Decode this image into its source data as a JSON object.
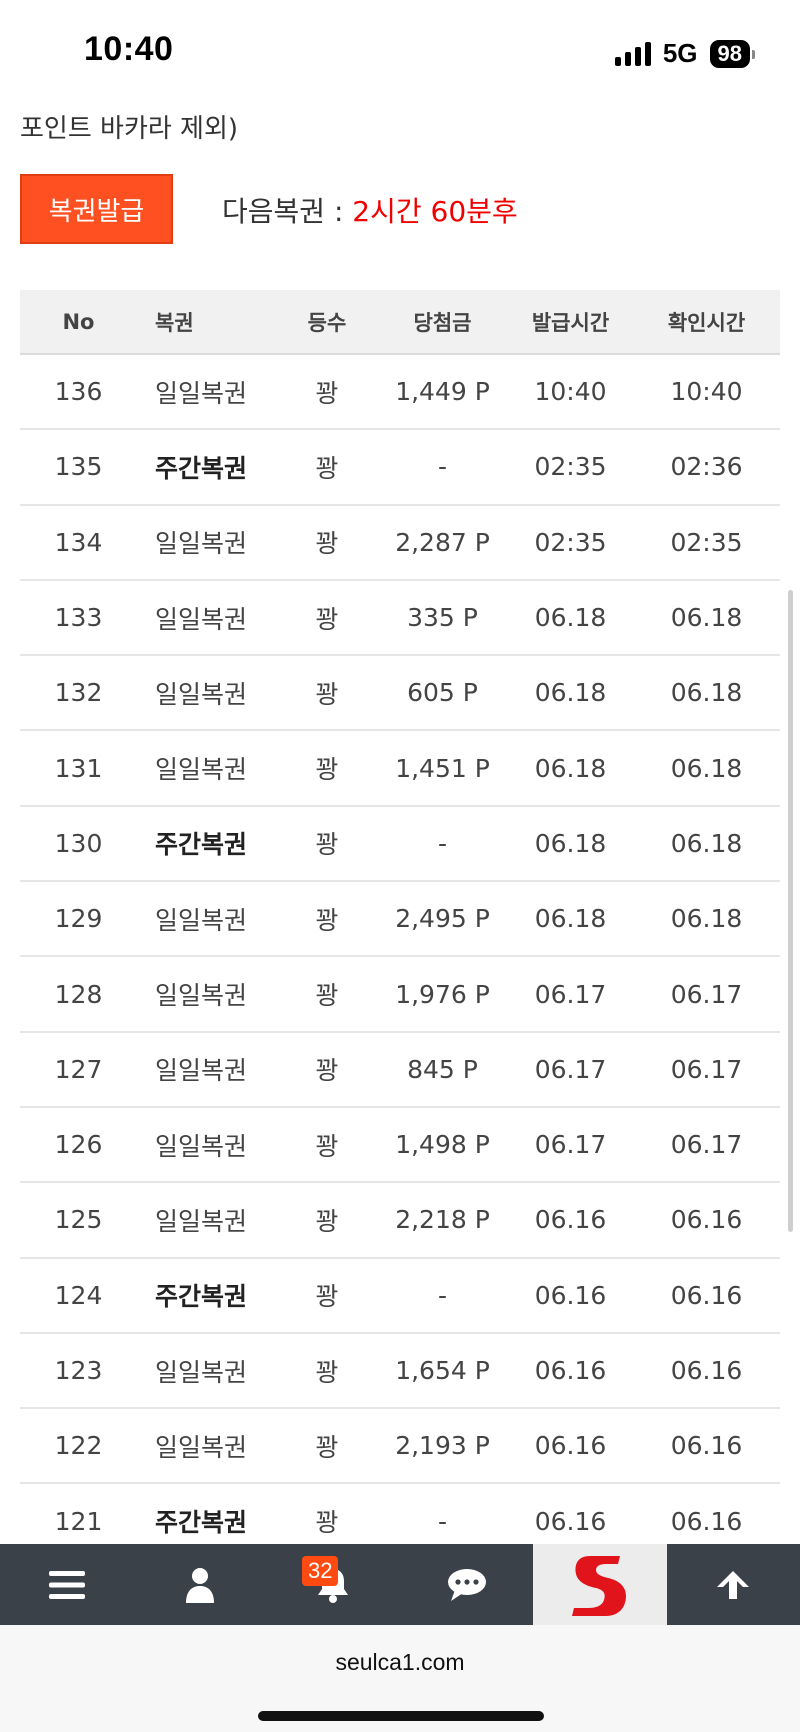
{
  "status": {
    "time": "10:40",
    "network": "5G",
    "battery": "98"
  },
  "notice": "포인트 바카라 제외)",
  "issue_button": "복권발급",
  "next": {
    "label": "다음복권 : ",
    "value": "2시간 60분후"
  },
  "table": {
    "headers": [
      "No",
      "복권",
      "등수",
      "당첨금",
      "발급시간",
      "확인시간"
    ],
    "rows": [
      {
        "no": "136",
        "name": "일일복권",
        "rank": "꽝",
        "prize": "1,449 P",
        "issued": "10:40",
        "checked": "10:40"
      },
      {
        "no": "135",
        "name": "주간복권",
        "rank": "꽝",
        "prize": "-",
        "issued": "02:35",
        "checked": "02:36"
      },
      {
        "no": "134",
        "name": "일일복권",
        "rank": "꽝",
        "prize": "2,287 P",
        "issued": "02:35",
        "checked": "02:35"
      },
      {
        "no": "133",
        "name": "일일복권",
        "rank": "꽝",
        "prize": "335 P",
        "issued": "06.18",
        "checked": "06.18"
      },
      {
        "no": "132",
        "name": "일일복권",
        "rank": "꽝",
        "prize": "605 P",
        "issued": "06.18",
        "checked": "06.18"
      },
      {
        "no": "131",
        "name": "일일복권",
        "rank": "꽝",
        "prize": "1,451 P",
        "issued": "06.18",
        "checked": "06.18"
      },
      {
        "no": "130",
        "name": "주간복권",
        "rank": "꽝",
        "prize": "-",
        "issued": "06.18",
        "checked": "06.18"
      },
      {
        "no": "129",
        "name": "일일복권",
        "rank": "꽝",
        "prize": "2,495 P",
        "issued": "06.18",
        "checked": "06.18"
      },
      {
        "no": "128",
        "name": "일일복권",
        "rank": "꽝",
        "prize": "1,976 P",
        "issued": "06.17",
        "checked": "06.17"
      },
      {
        "no": "127",
        "name": "일일복권",
        "rank": "꽝",
        "prize": "845 P",
        "issued": "06.17",
        "checked": "06.17"
      },
      {
        "no": "126",
        "name": "일일복권",
        "rank": "꽝",
        "prize": "1,498 P",
        "issued": "06.17",
        "checked": "06.17"
      },
      {
        "no": "125",
        "name": "일일복권",
        "rank": "꽝",
        "prize": "2,218 P",
        "issued": "06.16",
        "checked": "06.16"
      },
      {
        "no": "124",
        "name": "주간복권",
        "rank": "꽝",
        "prize": "-",
        "issued": "06.16",
        "checked": "06.16"
      },
      {
        "no": "123",
        "name": "일일복권",
        "rank": "꽝",
        "prize": "1,654 P",
        "issued": "06.16",
        "checked": "06.16"
      },
      {
        "no": "122",
        "name": "일일복권",
        "rank": "꽝",
        "prize": "2,193 P",
        "issued": "06.16",
        "checked": "06.16"
      },
      {
        "no": "121",
        "name": "주간복권",
        "rank": "꽝",
        "prize": "-",
        "issued": "06.16",
        "checked": "06.16"
      }
    ]
  },
  "bottom_nav": {
    "items": [
      {
        "icon": "menu-icon"
      },
      {
        "icon": "user-icon"
      },
      {
        "icon": "bell-icon",
        "badge": "32"
      },
      {
        "icon": "chat-icon"
      },
      {
        "icon": "site-logo"
      },
      {
        "icon": "arrow-up-icon"
      }
    ]
  },
  "url": "seulca1.com",
  "colors": {
    "accent": "#ff5022",
    "highlight": "#f20000",
    "nav_bg": "#3b4148"
  }
}
